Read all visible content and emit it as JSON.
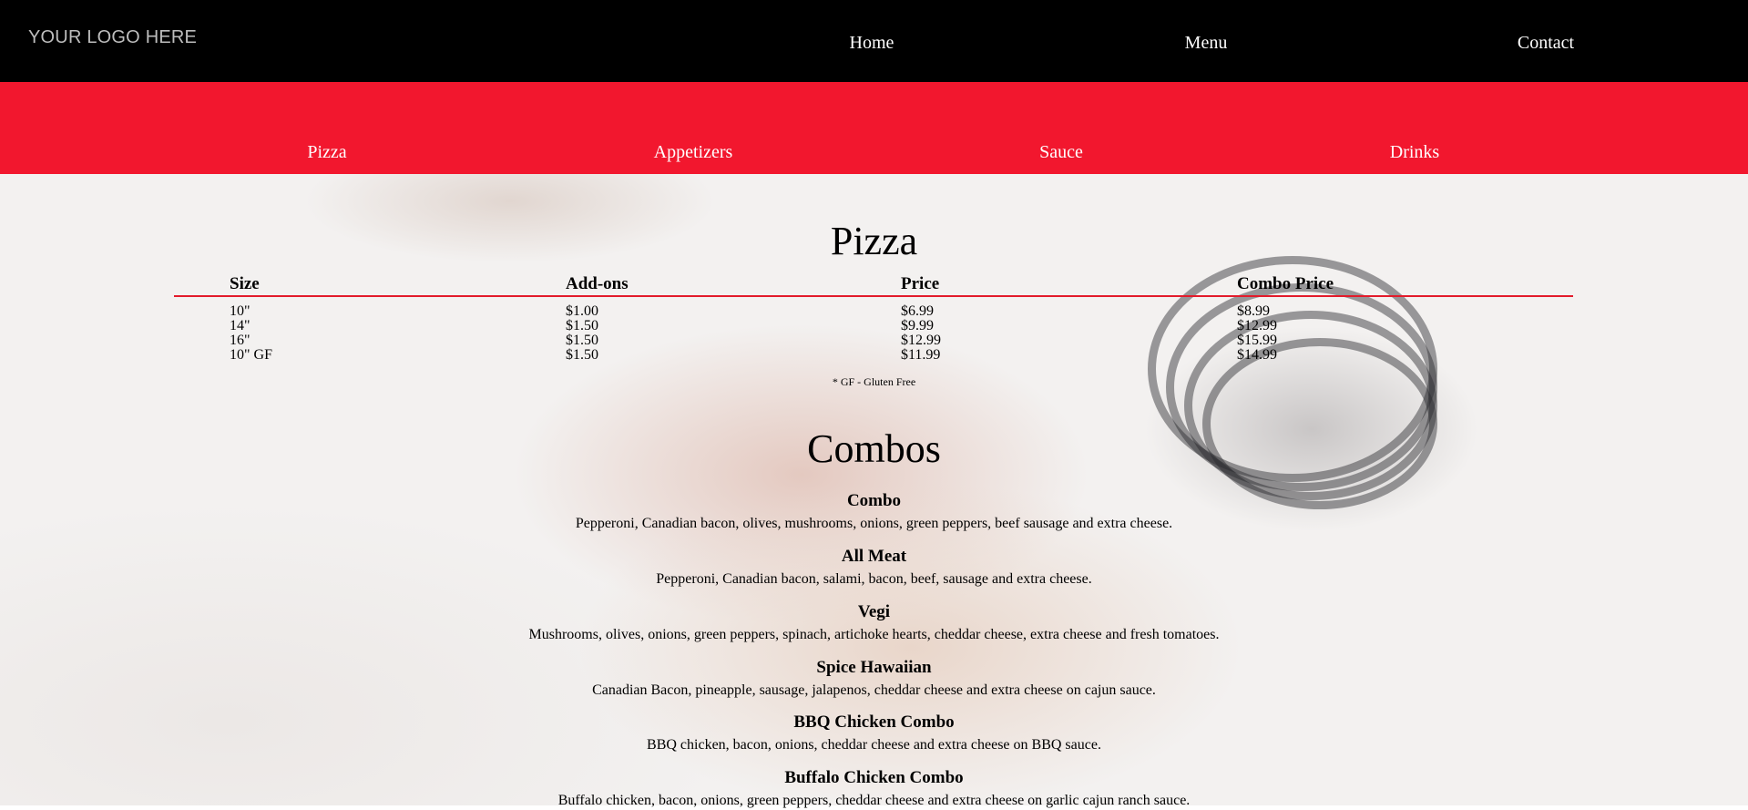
{
  "header": {
    "logo": "YOUR LOGO HERE",
    "nav": [
      "Home",
      "Menu",
      "Contact"
    ]
  },
  "subnav": [
    "Pizza",
    "Appetizers",
    "Sauce",
    "Drinks"
  ],
  "pizza": {
    "title": "Pizza",
    "columns": [
      "Size",
      "Add-ons",
      "Price",
      "Combo Price"
    ],
    "rows": [
      [
        "10\"",
        "$1.00",
        "$6.99",
        "$8.99"
      ],
      [
        "14\"",
        "$1.50",
        "$9.99",
        "$12.99"
      ],
      [
        "16\"",
        "$1.50",
        "$12.99",
        "$15.99"
      ],
      [
        "10\" GF",
        "$1.50",
        "$11.99",
        "$14.99"
      ]
    ],
    "footnote": "* GF - Gluten Free"
  },
  "combos": {
    "title": "Combos",
    "items": [
      {
        "name": "Combo",
        "desc": "Pepperoni, Canadian bacon, olives, mushrooms, onions, green peppers, beef sausage and extra cheese."
      },
      {
        "name": "All Meat",
        "desc": "Pepperoni, Canadian bacon, salami, bacon, beef, sausage and extra cheese."
      },
      {
        "name": "Vegi",
        "desc": "Mushrooms, olives, onions, green peppers, spinach, artichoke hearts, cheddar cheese, extra cheese and fresh tomatoes."
      },
      {
        "name": "Spice Hawaiian",
        "desc": "Canadian Bacon, pineapple, sausage, jalapenos, cheddar cheese and extra cheese on cajun sauce."
      },
      {
        "name": "BBQ Chicken Combo",
        "desc": "BBQ chicken, bacon, onions, cheddar cheese and extra cheese on BBQ sauce."
      },
      {
        "name": "Buffalo Chicken Combo",
        "desc": "Buffalo chicken, bacon, onions, green peppers, cheddar cheese and extra cheese on garlic cajun ranch sauce."
      }
    ]
  },
  "colors": {
    "header_bg": "#000000",
    "subnav_bg": "#f2172e",
    "rule": "#e31b2b"
  }
}
